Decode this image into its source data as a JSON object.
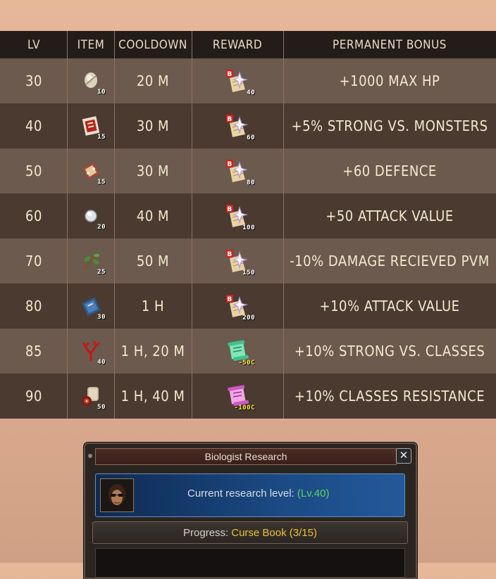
{
  "table": {
    "headers": {
      "lv": "LV",
      "item": "ITEM",
      "cooldown": "COOLDOWN",
      "reward": "REWARD",
      "bonus": "PERMANENT BONUS"
    },
    "rows": [
      {
        "lv": "30",
        "item_icon": "stone-item-icon",
        "item_qty": "10",
        "cooldown": "20 M",
        "reward_icon": "bonus-scroll-icon",
        "reward_qty": "40",
        "bonus": "+1000 MAX HP"
      },
      {
        "lv": "40",
        "item_icon": "curse-book-icon",
        "item_qty": "15",
        "cooldown": "30 M",
        "reward_icon": "bonus-scroll-icon",
        "reward_qty": "60",
        "bonus": "+5% STRONG VS. MONSTERS"
      },
      {
        "lv": "50",
        "item_icon": "scroll-item-icon",
        "item_qty": "15",
        "cooldown": "30 M",
        "reward_icon": "bonus-scroll-icon",
        "reward_qty": "80",
        "bonus": "+60 DEFENCE"
      },
      {
        "lv": "60",
        "item_icon": "crystal-icon",
        "item_qty": "20",
        "cooldown": "40 M",
        "reward_icon": "bonus-scroll-icon",
        "reward_qty": "100",
        "bonus": "+50 ATTACK VALUE"
      },
      {
        "lv": "70",
        "item_icon": "branch-icon",
        "item_qty": "25",
        "cooldown": "50 M",
        "reward_icon": "bonus-scroll-icon",
        "reward_qty": "150",
        "bonus": "-10% DAMAGE RECIEVED PVM"
      },
      {
        "lv": "80",
        "item_icon": "blue-book-icon",
        "item_qty": "30",
        "cooldown": "1 H",
        "reward_icon": "bonus-scroll-icon",
        "reward_qty": "200",
        "bonus": "+10% ATTACK VALUE"
      },
      {
        "lv": "85",
        "item_icon": "red-coral-icon",
        "item_qty": "40",
        "cooldown": "1 H, 20 M",
        "reward_icon": "green-scroll-icon",
        "reward_qty": "-50C",
        "bonus": "+10% STRONG VS. CLASSES"
      },
      {
        "lv": "90",
        "item_icon": "scroll-seal-icon",
        "item_qty": "50",
        "cooldown": "1 H, 40 M",
        "reward_icon": "pink-scroll-icon",
        "reward_qty": "-100C",
        "bonus": "+10% CLASSES RESISTANCE"
      }
    ]
  },
  "window": {
    "title": "Biologist Research",
    "close_label": "✕",
    "research_label": "Current research level:",
    "research_level": "(Lv.40)",
    "progress_label": "Progress:",
    "progress_value": "Curse Book (3/15)"
  },
  "colors": {
    "header_bg": "#241c19",
    "row_light": "#6b5a4d",
    "row_dark": "#4a3a30",
    "text": "#f3e9cd",
    "level_green": "#5ad45a",
    "progress_gold": "#e8c23a"
  }
}
